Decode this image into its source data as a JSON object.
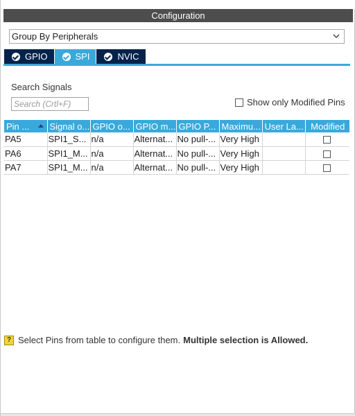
{
  "panel": {
    "title": "Configuration"
  },
  "group_select": {
    "value": "Group By Peripherals"
  },
  "tabs": [
    {
      "label": "GPIO",
      "active": false
    },
    {
      "label": "SPI",
      "active": true
    },
    {
      "label": "NVIC",
      "active": false
    }
  ],
  "search": {
    "label": "Search Signals",
    "placeholder": "Search (Crtl+F)"
  },
  "modified_filter": {
    "label": "Show only Modified Pins",
    "checked": false
  },
  "table": {
    "columns": [
      "Pin ...",
      "Signal o...",
      "GPIO o...",
      "GPIO m...",
      "GPIO P...",
      "Maximu...",
      "User La...",
      "Modified"
    ],
    "rows": [
      {
        "pin": "PA5",
        "signal": "SPI1_S...",
        "gpio_output": "n/a",
        "gpio_mode": "Alternat...",
        "gpio_pull": "No pull-...",
        "max_speed": "Very High",
        "user_label": "",
        "modified": false
      },
      {
        "pin": "PA6",
        "signal": "SPI1_M...",
        "gpio_output": "n/a",
        "gpio_mode": "Alternat...",
        "gpio_pull": "No pull-...",
        "max_speed": "Very High",
        "user_label": "",
        "modified": false
      },
      {
        "pin": "PA7",
        "signal": "SPI1_M...",
        "gpio_output": "n/a",
        "gpio_mode": "Alternat...",
        "gpio_pull": "No pull-...",
        "max_speed": "Very High",
        "user_label": "",
        "modified": false
      }
    ]
  },
  "hint": {
    "icon": "help-icon",
    "icon_glyph": "?",
    "text": "Select Pins from table to configure them.",
    "bold_text": "Multiple selection is Allowed."
  },
  "colors": {
    "accent": "#39a9dc",
    "tab_dark": "#03234b",
    "title_bar": "#4d4d4d"
  }
}
